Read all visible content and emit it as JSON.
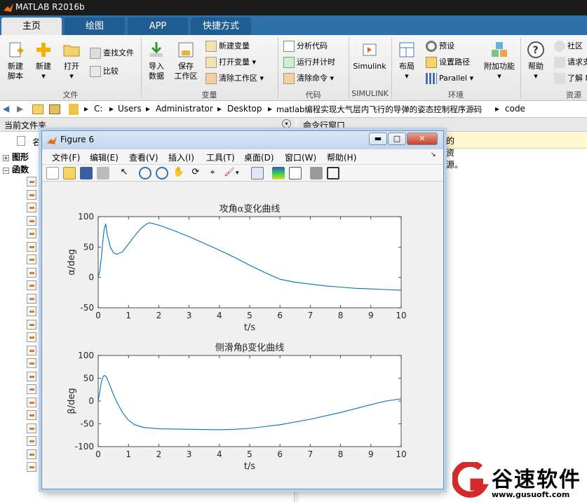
{
  "app": {
    "title": "MATLAB R2016b"
  },
  "tabs": [
    "主页",
    "绘图",
    "APP",
    "快捷方式"
  ],
  "ribbon": {
    "new_script": [
      "新建",
      "脚本"
    ],
    "new": "新建",
    "open": "打开",
    "find_files": "查找文件",
    "compare": "比较",
    "import": [
      "导入",
      "数据"
    ],
    "save_ws": [
      "保存",
      "工作区"
    ],
    "new_var": "新建变量",
    "open_var": "打开变量",
    "clear_ws": "清除工作区",
    "analyze": "分析代码",
    "run_time": "运行并计时",
    "clear_cmd": "清除命令",
    "simulink": "Simulink",
    "layout": "布局",
    "prefs": "预设",
    "set_path": "设置路径",
    "parallel": "Parallel",
    "addons": "附加功能",
    "help": "帮助",
    "community": "社区",
    "request": "请求支",
    "learn": "了解 M",
    "groups": [
      "文件",
      "变量",
      "代码",
      "SIMULINK",
      "环境",
      "资源"
    ]
  },
  "address": {
    "crumbs": [
      "C:",
      "Users",
      "Administrator",
      "Desktop",
      "matlab编程实现大气层内飞行的导弹的姿态控制程序源码",
      "code"
    ]
  },
  "left_panel": {
    "title": "当前文件夹",
    "col_name": "名",
    "tree": [
      "图形",
      "函数"
    ]
  },
  "right_panel": {
    "title": "命令行窗口",
    "banner": "的资源。"
  },
  "figure": {
    "title": "Figure 6",
    "menu": [
      "文件(F)",
      "编辑(E)",
      "查看(V)",
      "插入(I)",
      "工具(T)",
      "桌面(D)",
      "窗口(W)",
      "帮助(H)"
    ]
  },
  "chart_data": [
    {
      "type": "line",
      "title": "攻角α变化曲线",
      "xlabel": "t/s",
      "ylabel": "α/deg",
      "xlim": [
        0,
        10
      ],
      "ylim": [
        -50,
        100
      ],
      "xticks": [
        0,
        1,
        2,
        3,
        4,
        5,
        6,
        7,
        8,
        9,
        10
      ],
      "yticks": [
        100,
        50,
        0,
        -50
      ],
      "grid": false,
      "color": "#0072bd",
      "x": [
        0,
        0.05,
        0.1,
        0.15,
        0.2,
        0.25,
        0.3,
        0.4,
        0.5,
        0.6,
        0.8,
        1.0,
        1.2,
        1.4,
        1.6,
        1.7,
        2.0,
        2.5,
        3.0,
        3.5,
        4.0,
        4.5,
        5.0,
        5.5,
        6.0,
        6.5,
        7.0,
        7.5,
        8.0,
        8.5,
        9.0,
        9.5,
        10
      ],
      "y": [
        0,
        10,
        30,
        58,
        80,
        88,
        70,
        50,
        41,
        38,
        42,
        55,
        68,
        80,
        88,
        90,
        86,
        77,
        67,
        56,
        45,
        33,
        20,
        8,
        -3,
        -8,
        -11,
        -14,
        -16,
        -18,
        -19,
        -20,
        -21
      ]
    },
    {
      "type": "line",
      "title": "侧滑角β变化曲线",
      "xlabel": "t/s",
      "ylabel": "β/deg",
      "xlim": [
        0,
        10
      ],
      "ylim": [
        -100,
        100
      ],
      "xticks": [
        0,
        1,
        2,
        3,
        4,
        5,
        6,
        7,
        8,
        9,
        10
      ],
      "yticks": [
        100,
        50,
        0,
        -50,
        -100
      ],
      "grid": false,
      "color": "#0072bd",
      "x": [
        0,
        0.05,
        0.1,
        0.15,
        0.2,
        0.25,
        0.3,
        0.4,
        0.5,
        0.6,
        0.8,
        1.0,
        1.2,
        1.5,
        2.0,
        3.0,
        4.0,
        4.5,
        5.0,
        6.0,
        7.0,
        8.0,
        9.0,
        9.5,
        10
      ],
      "y": [
        0,
        20,
        40,
        52,
        56,
        55,
        48,
        32,
        15,
        0,
        -25,
        -42,
        -52,
        -58,
        -61,
        -62,
        -63,
        -62,
        -60,
        -52,
        -40,
        -25,
        -8,
        0,
        5
      ]
    }
  ],
  "watermark": {
    "logo_text": "谷速软件",
    "url": "www.gusuoft.com"
  }
}
